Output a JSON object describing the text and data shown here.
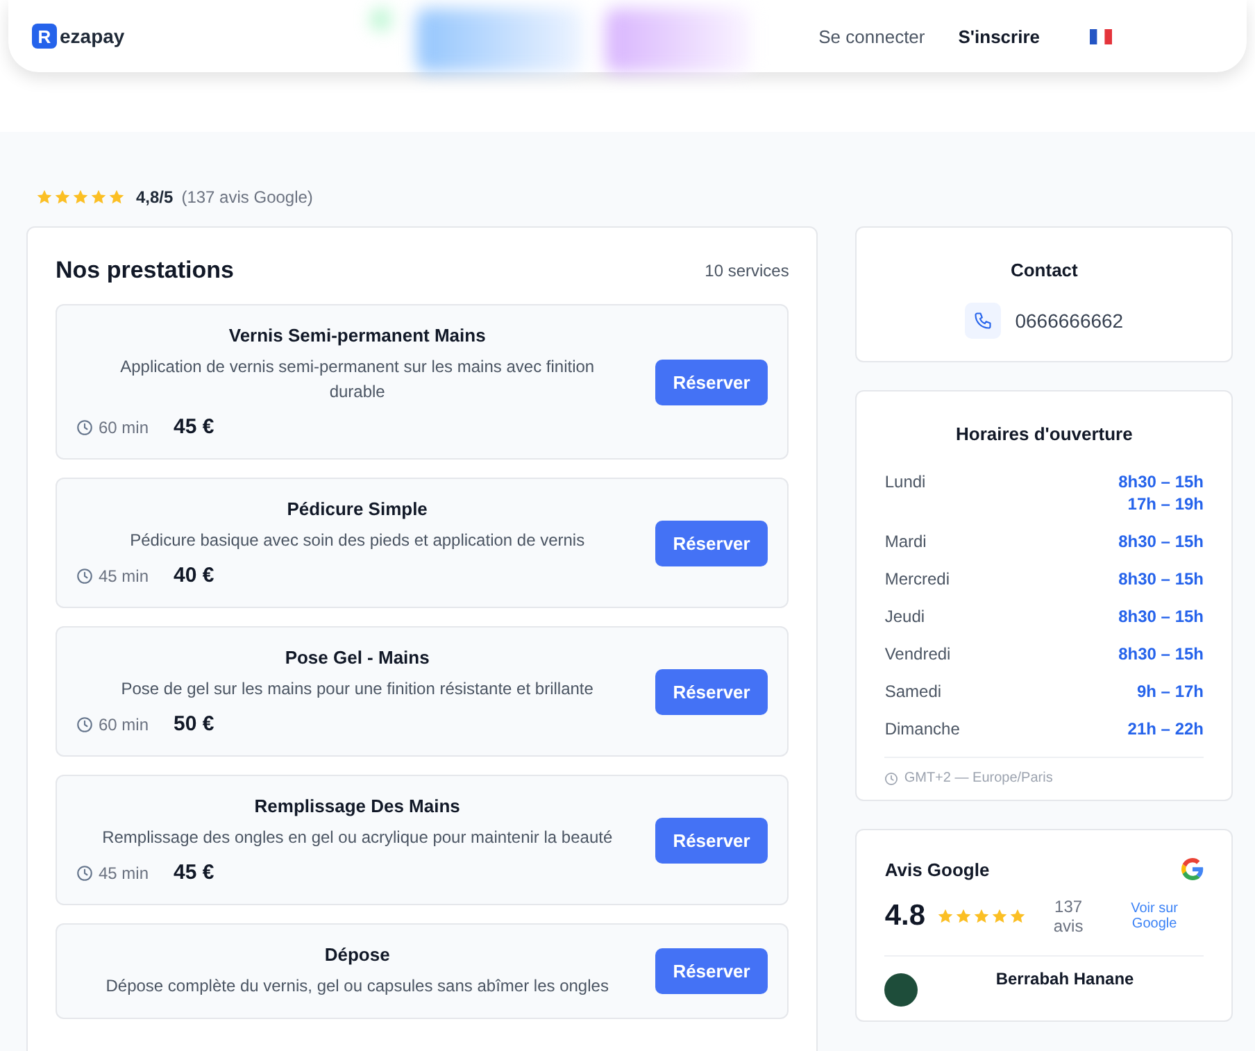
{
  "header": {
    "logo_letter": "R",
    "logo_text": "ezapay",
    "links": [
      {
        "label": "Se connecter",
        "kind": "plain"
      },
      {
        "label": "S'inscrire",
        "kind": "bold"
      }
    ]
  },
  "rating": {
    "stars": 5,
    "score": "4,8/5",
    "count": "(137 avis Google)"
  },
  "services": {
    "title": "Nos prestations",
    "count": "10 services",
    "items": [
      {
        "name": "Vernis Semi-permanent Mains",
        "description": "Application de vernis semi-permanent sur les mains avec finition durable",
        "duration": "60 min",
        "price": "45 €",
        "button": "Réserver"
      },
      {
        "name": "Pédicure Simple",
        "description": "Pédicure basique avec soin des pieds et application de vernis",
        "duration": "45 min",
        "price": "40 €",
        "button": "Réserver"
      },
      {
        "name": "Pose Gel - Mains",
        "description": "Pose de gel sur les mains pour une finition résistante et brillante",
        "duration": "60 min",
        "price": "50 €",
        "button": "Réserver"
      },
      {
        "name": "Remplissage Des Mains",
        "description": "Remplissage des ongles en gel ou acrylique pour maintenir la beauté",
        "duration": "45 min",
        "price": "45 €",
        "button": "Réserver"
      },
      {
        "name": "Dépose",
        "description": "Dépose complète du vernis, gel ou capsules sans abîmer les ongles",
        "button": "Réserver"
      }
    ]
  },
  "contact": {
    "title": "Contact",
    "phone": "0666666662"
  },
  "hours": {
    "title": "Horaires d'ouverture",
    "days": [
      {
        "day": "Lundi",
        "slots": [
          "8h30 – 15h",
          "17h – 19h"
        ]
      },
      {
        "day": "Mardi",
        "slots": [
          "8h30 – 15h"
        ]
      },
      {
        "day": "Mercredi",
        "slots": [
          "8h30 – 15h"
        ]
      },
      {
        "day": "Jeudi",
        "slots": [
          "8h30 – 15h"
        ]
      },
      {
        "day": "Vendredi",
        "slots": [
          "8h30 – 15h"
        ]
      },
      {
        "day": "Samedi",
        "slots": [
          "9h – 17h"
        ]
      },
      {
        "day": "Dimanche",
        "slots": [
          "21h – 22h"
        ]
      }
    ],
    "timezone": "GMT+2 — Europe/Paris"
  },
  "reviews": {
    "title": "Avis Google",
    "score": "4.8",
    "stars": 5,
    "count": "137 avis",
    "link": "Voir sur Google",
    "first_reviewer": "Berrabah Hanane"
  }
}
